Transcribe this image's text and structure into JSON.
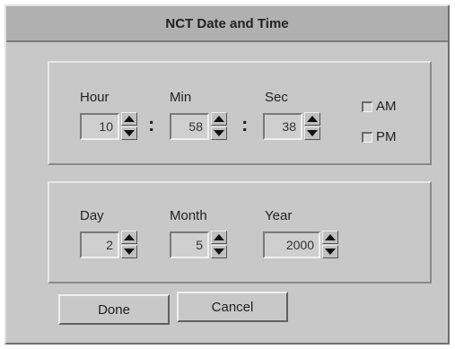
{
  "window": {
    "title": "NCT Date and Time"
  },
  "time": {
    "hour_label": "Hour",
    "min_label": "Min",
    "sec_label": "Sec",
    "hour": "10",
    "min": "58",
    "sec": "38",
    "separator": ":",
    "am_label": "AM",
    "pm_label": "PM"
  },
  "date": {
    "day_label": "Day",
    "month_label": "Month",
    "year_label": "Year",
    "day": "2",
    "month": "5",
    "year": "2000"
  },
  "buttons": {
    "done": "Done",
    "cancel": "Cancel"
  },
  "icons": {
    "spinner_up": "triangle-up-icon",
    "spinner_down": "triangle-down-icon"
  }
}
